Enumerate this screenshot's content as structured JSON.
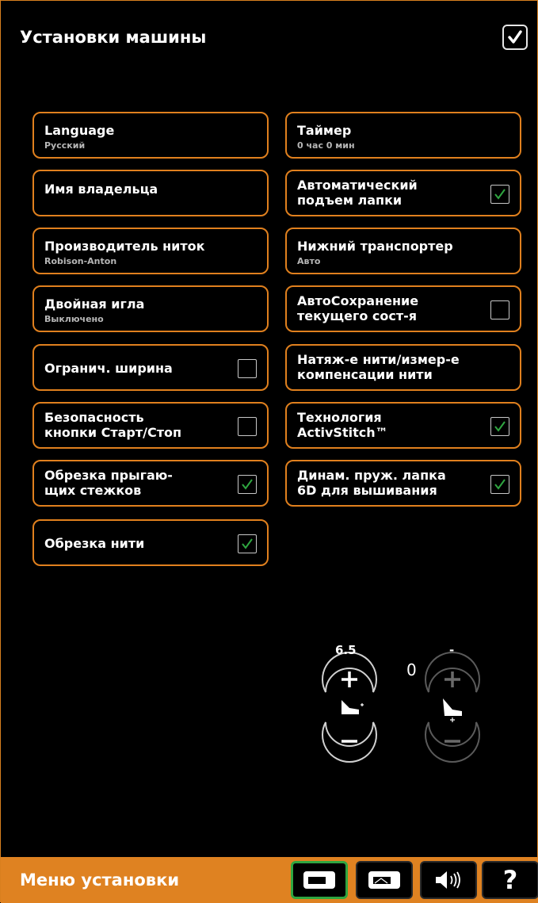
{
  "header": {
    "title": "Установки машины"
  },
  "tiles_left": [
    {
      "label": "Language",
      "sub": "Русский"
    },
    {
      "label": "Имя владельца"
    },
    {
      "label": "Производитель ниток",
      "sub": "Robison-Anton"
    },
    {
      "label": "Двойная игла",
      "sub": "Выключено"
    },
    {
      "label": "Огранич. ширина",
      "checked": false
    },
    {
      "label1": "Безопасность",
      "label2": "кнопки Старт/Стоп",
      "checked": false
    },
    {
      "label1": "Обрезка прыгаю-",
      "label2": "щих стежков",
      "checked": true
    },
    {
      "label": "Обрезка нити",
      "checked": true
    }
  ],
  "tiles_right": [
    {
      "label": "Таймер",
      "sub": "0 час 0 мин"
    },
    {
      "label1": "Автоматический",
      "label2": "подъем лапки",
      "checked": true
    },
    {
      "label": "Нижний транспортер",
      "sub": "Авто"
    },
    {
      "label1": "АвтоСохранение",
      "label2": "текущего сост-я",
      "checked": false
    },
    {
      "label1": "Натяж-е нити/измер-е",
      "label2": "компенсации нити"
    },
    {
      "label1": "Технология",
      "label2": "ActivStitch™",
      "checked": true
    },
    {
      "label1": "Динам. пруж. лапка",
      "label2": "6D для вышивания",
      "checked": true
    }
  ],
  "presser_foot": {
    "left_value": "6.5",
    "right_value": "-",
    "indicator": "0"
  },
  "bottom_bar": {
    "title": "Меню установки",
    "help_label": "?"
  },
  "colors": {
    "accent": "#df8221",
    "check": "#2fa640"
  },
  "icons": [
    "checkmark-icon",
    "sewing-machine-icon",
    "embroidery-machine-icon",
    "speaker-icon",
    "help-icon",
    "presser-foot-icon"
  ]
}
